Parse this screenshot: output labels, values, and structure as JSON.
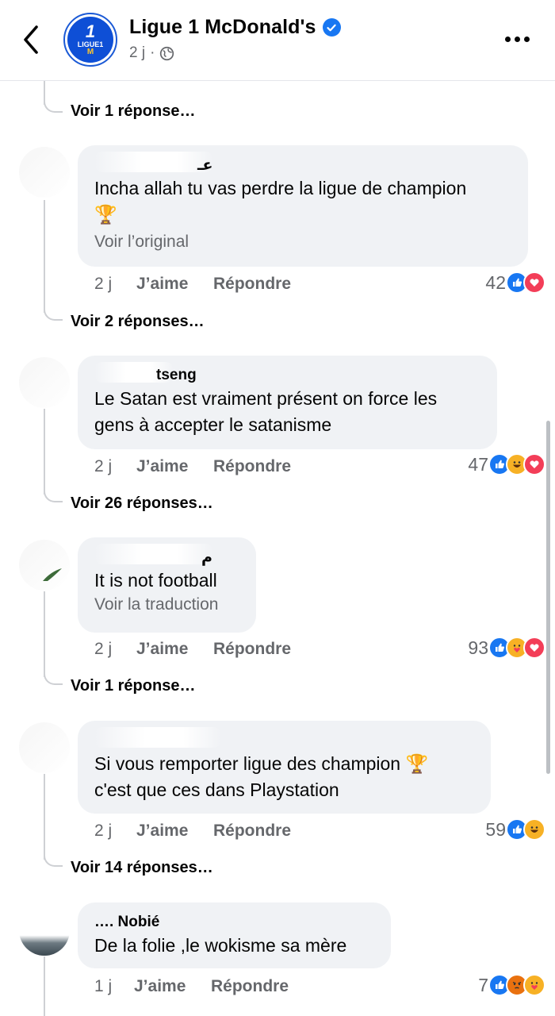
{
  "header": {
    "page_name": "Ligue 1 McDonald's",
    "time": "2 j",
    "separator": "·",
    "logo_big": "1",
    "logo_small": "LIGUE1",
    "logo_m": "M"
  },
  "comments": [
    {
      "author": "عـ",
      "text_line1": "Incha allah tu vas perdre la ligue de champion",
      "text_line2": "🏆",
      "sub": "Voir l’original",
      "time": "2 j",
      "like": "J’aime",
      "reply": "Répondre",
      "count": "42",
      "reactions": [
        "like",
        "love"
      ],
      "replies": "Voir 2 réponses…"
    },
    {
      "author": "tseng",
      "text_line1": "Le Satan est vraiment présent on force les",
      "text_line2": "gens à accepter le satanisme",
      "time": "2 j",
      "like": "J’aime",
      "reply": "Répondre",
      "count": "47",
      "reactions": [
        "like",
        "haha",
        "love"
      ],
      "replies": "Voir 26 réponses…"
    },
    {
      "author": "م",
      "text_line1": "It is not football",
      "sub": "Voir la traduction",
      "time": "2 j",
      "like": "J’aime",
      "reply": "Répondre",
      "count": "93",
      "reactions": [
        "like",
        "care",
        "love"
      ],
      "replies": "Voir 1 réponse…"
    },
    {
      "author": "",
      "text_line1": "Si vous remporter ligue des champion 🏆",
      "text_line2": "c'est que ces dans Playstation",
      "time": "2 j",
      "like": "J’aime",
      "reply": "Répondre",
      "count": "59",
      "reactions": [
        "like",
        "haha"
      ],
      "replies": "Voir 14 réponses…"
    },
    {
      "author": "…. Nobié",
      "text_line1": "De la folie ,le wokisme sa mère",
      "time": "1 j",
      "like": "J’aime",
      "reply": "Répondre",
      "count": "7",
      "reactions": [
        "like",
        "angry",
        "care"
      ]
    }
  ],
  "top_replies": "Voir 1 réponse…",
  "icons": {
    "back": "chevron-left-icon",
    "verified": "verified-badge-icon",
    "globe": "globe-icon",
    "more": "more-dots-icon"
  },
  "colors": {
    "accent": "#1877f2",
    "bubble": "#f0f2f5",
    "secondary_text": "#65676b",
    "love": "#f33e58",
    "haha": "#f7b125"
  }
}
